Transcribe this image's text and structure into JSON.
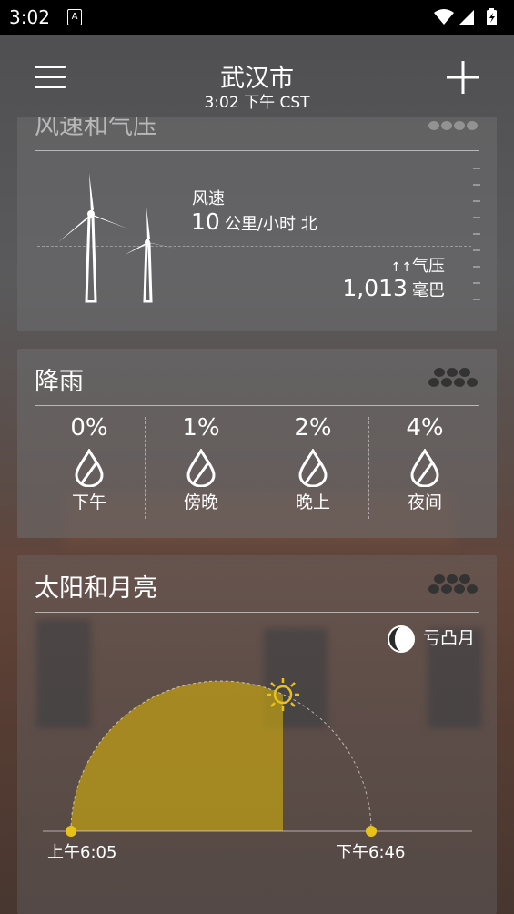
{
  "status_bar": {
    "time": "3:02",
    "notification_letter": "A"
  },
  "header": {
    "city": "武汉市",
    "local_time": "3:02 下午 CST"
  },
  "wind_pressure": {
    "title": "风速和气压",
    "wind_label": "风速",
    "wind_value": "10",
    "wind_unit": "公里/小时 北",
    "pressure_trend": "↑↑",
    "pressure_label": "气压",
    "pressure_value": "1,013",
    "pressure_unit": "毫巴"
  },
  "precipitation": {
    "title": "降雨",
    "periods": [
      {
        "pct": "0%",
        "label": "下午"
      },
      {
        "pct": "1%",
        "label": "傍晚"
      },
      {
        "pct": "2%",
        "label": "晚上"
      },
      {
        "pct": "4%",
        "label": "夜间"
      }
    ]
  },
  "sun_moon": {
    "title": "太阳和月亮",
    "moon_phase": "亏凸月",
    "sunrise": "上午6:05",
    "sunset": "下午6:46",
    "sun_color": "#e8c21a"
  },
  "icons": [
    "menu-icon",
    "add-icon",
    "wind-turbine-icon",
    "drop-icon",
    "sun-icon",
    "moon-icon",
    "more-dots-icon"
  ]
}
